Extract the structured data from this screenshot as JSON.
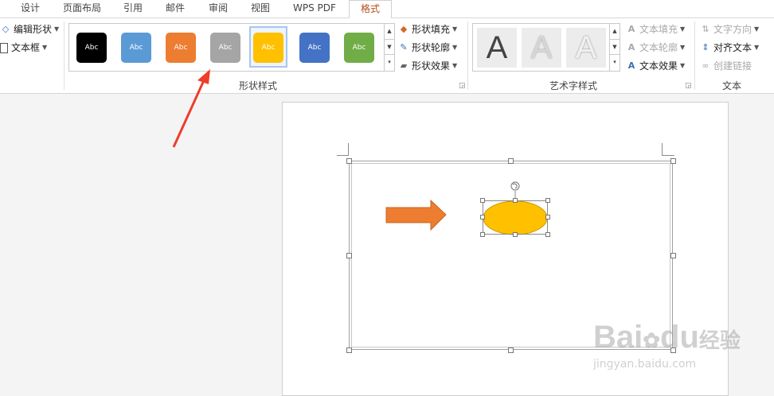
{
  "tabs": [
    {
      "label": "设计"
    },
    {
      "label": "页面布局"
    },
    {
      "label": "引用"
    },
    {
      "label": "邮件"
    },
    {
      "label": "审阅"
    },
    {
      "label": "视图"
    },
    {
      "label": "WPS PDF"
    },
    {
      "label": "格式",
      "active": true
    }
  ],
  "insert_shapes": {
    "edit_shape": "编辑形状",
    "text_box": "文本框"
  },
  "shape_styles": {
    "group_label": "形状样式",
    "swatches": [
      {
        "text": "Abc",
        "color": "#000000"
      },
      {
        "text": "Abc",
        "color": "#5b9bd5"
      },
      {
        "text": "Abc",
        "color": "#ed7d31"
      },
      {
        "text": "Abc",
        "color": "#a5a5a5"
      },
      {
        "text": "Abc",
        "color": "#ffc000",
        "selected": true
      },
      {
        "text": "Abc",
        "color": "#4472c4"
      },
      {
        "text": "Abc",
        "color": "#70ad47"
      }
    ],
    "fill": "形状填充",
    "outline": "形状轮廓",
    "effects": "形状效果"
  },
  "wordart": {
    "group_label": "艺术字样式",
    "samples": [
      "A",
      "A",
      "A"
    ],
    "text_fill": "文本填充",
    "text_outline": "文本轮廓",
    "text_effects": "文本效果"
  },
  "text_group": {
    "group_label": "文本",
    "text_direction": "文字方向",
    "align_text": "对齐文本",
    "create_link": "创建链接"
  },
  "document": {
    "arrow_color": "#ed7d31",
    "ellipse_fill": "#ffc000",
    "ellipse_stroke": "#c99a00"
  },
  "annotation": {
    "arrow_color": "#f03c2a"
  },
  "watermark": {
    "brand": "Bai",
    "brand_suffix": "du",
    "cn": "经验",
    "url": "jingyan.baidu.com"
  },
  "colors": {
    "active_tab": "#b5501a",
    "selection": "#a8c6ef"
  }
}
